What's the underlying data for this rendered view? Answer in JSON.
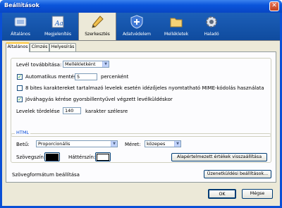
{
  "window": {
    "title": "Beállítások",
    "close_glyph": "✕"
  },
  "toolbar": {
    "panes": [
      {
        "label": "Általános",
        "icon": "general-icon"
      },
      {
        "label": "Megjelenítés",
        "icon": "display-icon"
      },
      {
        "label": "Szerkesztés",
        "icon": "pencil-icon"
      },
      {
        "label": "Adatvédelem",
        "icon": "shield-icon"
      },
      {
        "label": "Mellékletek",
        "icon": "folder-icon"
      },
      {
        "label": "Haladó",
        "icon": "gear-icon"
      }
    ],
    "active": "Szerkesztés"
  },
  "tabs": [
    "Általános",
    "Címzés",
    "Helyesírás"
  ],
  "general": {
    "forward_label": "Levél továbbítása:",
    "forward_value": "Mellékletként",
    "autosave_label": "Automatikus mentés",
    "autosave_value": "5",
    "autosave_unit": "percenként",
    "autosave_checked": true,
    "eightbit_label": "8 bites karaktereket tartalmazó levelek esetén idézőjeles nyomtatható MIME-kódolás használata",
    "eightbit_checked": false,
    "confirm_label": "Jóváhagyás kérése gyorsbillentyűvel végzett levélküldéskor",
    "confirm_checked": true,
    "wrap_label": "Levelek tördelése",
    "wrap_value": "140",
    "wrap_unit": "karakter szélesre"
  },
  "html": {
    "group_label": "HTML",
    "font_label": "Betű:",
    "font_value": "Proporcionális",
    "size_label": "Méret:",
    "size_value": "közepes",
    "text_color_label": "Szövegszín:",
    "text_color": "#000000",
    "bg_color_label": "Háttérszín:",
    "bg_color": "#ffffff",
    "reset_button": "Alapértelmezett értékek visszaállítása"
  },
  "format": {
    "label": "Szövegformátum beállítása",
    "button": "Üzenetküldési beállítások..."
  },
  "footer": {
    "ok": "OK",
    "cancel": "Mégse"
  },
  "colors": {
    "titlebar": "#0a55db",
    "toolbar": "#1c5fb8",
    "dialog": "#ece9d8",
    "check": "#21a121"
  }
}
